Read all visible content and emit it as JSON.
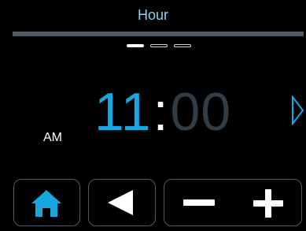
{
  "header": {
    "title": "Hour",
    "page_indicator": {
      "total": 3,
      "active": 1
    }
  },
  "clock": {
    "hour": "11",
    "separator": ":",
    "minutes": "00",
    "period": "AM",
    "selected_field": "hour"
  },
  "navigation": {
    "next_icon": "chevron-right-icon"
  },
  "toolbar": {
    "home_icon": "home-icon",
    "back_icon": "back-arrow-icon",
    "minus_icon": "minus-icon",
    "plus_icon": "plus-icon"
  },
  "colors": {
    "background": "#000000",
    "accent": "#17a7e3",
    "title": "#8fd3f0",
    "divider": "#4e5a63",
    "inactive_digits": "#313c45",
    "text": "#ffffff",
    "button_border": "#4e5a63"
  }
}
